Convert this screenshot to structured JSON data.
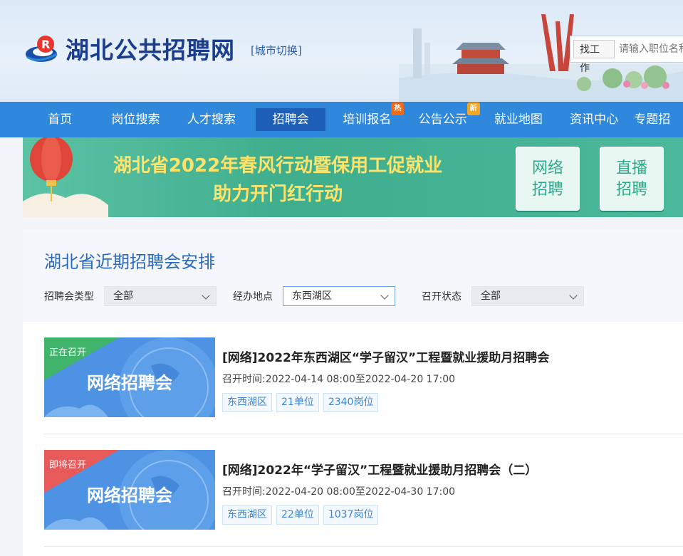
{
  "header": {
    "logo_text": "湖北公共招聘网",
    "city_switch": "[城市切换]",
    "search_type": "找工作",
    "search_placeholder": "请输入职位名称"
  },
  "nav": {
    "items": [
      {
        "label": "首页"
      },
      {
        "label": "岗位搜索"
      },
      {
        "label": "人才搜索"
      },
      {
        "label": "招聘会",
        "active": true
      },
      {
        "label": "培训报名",
        "badge": "热"
      },
      {
        "label": "公告公示",
        "badge": "新"
      },
      {
        "label": "就业地图"
      },
      {
        "label": "资讯中心"
      },
      {
        "label": "专题招"
      }
    ]
  },
  "banner": {
    "line1": "湖北省2022年春风行动暨保用工促就业",
    "line2": "助力开门红行动",
    "btn_online_1": "网络",
    "btn_online_2": "招聘",
    "btn_live_1": "直播",
    "btn_live_2": "招聘"
  },
  "panel": {
    "title": "湖北省近期招聘会安排",
    "filters": {
      "type_label": "招聘会类型",
      "type_value": "全部",
      "location_label": "经办地点",
      "location_value": "东西湖区",
      "status_label": "召开状态",
      "status_value": "全部"
    }
  },
  "fairs": [
    {
      "status": "正在召开",
      "status_color": "#3fb46a",
      "thumb_text": "网络招聘会",
      "title": "[网络]2022年东西湖区“学子留汉”工程暨就业援助月招聘会",
      "time": "召开时间:2022-04-14 08:00至2022-04-20 17:00",
      "district": "东西湖区",
      "units": "21单位",
      "positions": "2340岗位"
    },
    {
      "status": "即将召开",
      "status_color": "#e85a5a",
      "thumb_text": "网络招聘会",
      "title": "[网络]2022年“学子留汉”工程暨就业援助月招聘会（二）",
      "time": "召开时间:2022-04-20 08:00至2022-04-30 17:00",
      "district": "东西湖区",
      "units": "22单位",
      "positions": "1037岗位"
    }
  ],
  "colors": {
    "nav_bg": "#2f88dc",
    "nav_active": "#1e5fb8",
    "banner_bg": "#3fae8d",
    "title_blue": "#2a6bc2"
  }
}
